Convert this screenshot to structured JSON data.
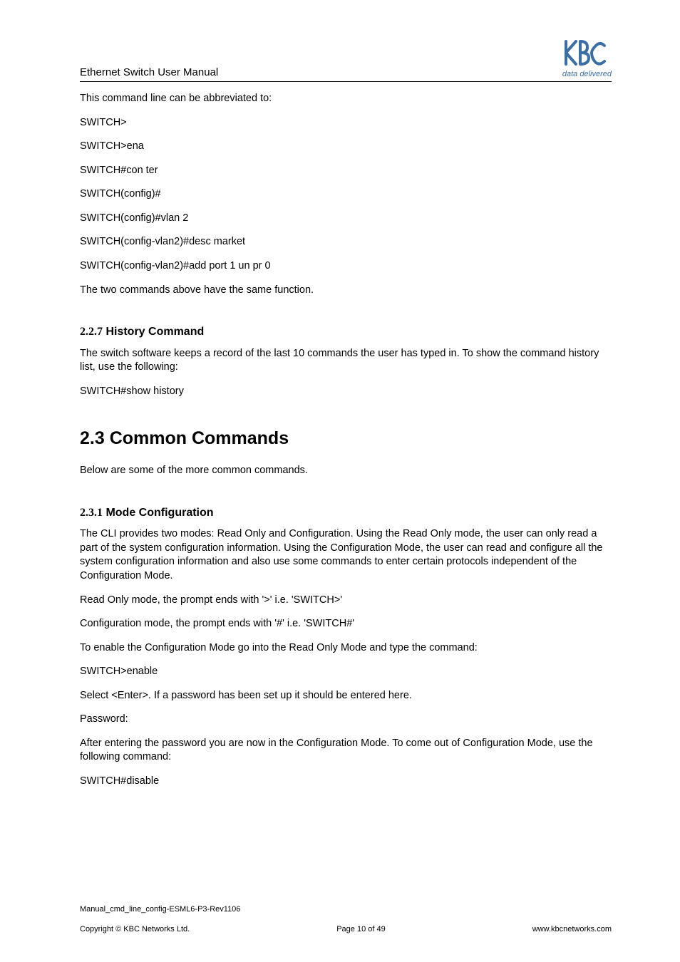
{
  "header": {
    "title": "Ethernet Switch User Manual",
    "tagline": "data delivered"
  },
  "body": {
    "intro": "This command line can be abbreviated to:",
    "cmd1": "SWITCH>",
    "cmd2": "SWITCH>ena",
    "cmd3": "SWITCH#con ter",
    "cmd4": "SWITCH(config)#",
    "cmd5": "SWITCH(config)#vlan 2",
    "cmd6": "SWITCH(config-vlan2)#desc market",
    "cmd7": "SWITCH(config-vlan2)#add port 1 un pr 0",
    "cmd_note": "The two commands above have the same function.",
    "sec227_num": "2.2.7",
    "sec227_title": " History Command",
    "sec227_p1": "The switch software keeps a record of the last 10 commands the user has typed in. To show the command history list, use the following:",
    "sec227_cmd": "SWITCH#show history",
    "sec23_title": "2.3 Common Commands",
    "sec23_p1": "Below are some of the more common commands.",
    "sec231_num": "2.3.1",
    "sec231_title": " Mode Configuration",
    "sec231_p1": "The CLI provides two modes: Read Only and Configuration. Using the Read Only mode, the user can only read a part of the system configuration information. Using the Configuration Mode, the user can read and configure all the system configuration information and also use some commands to enter certain protocols independent of the Configuration Mode.",
    "sec231_p2": "Read Only mode, the prompt ends with '>' i.e. 'SWITCH>'",
    "sec231_p3": "Configuration mode, the prompt ends with '#' i.e. 'SWITCH#'",
    "sec231_p4": "To enable the Configuration Mode go into the Read Only Mode and type the command:",
    "sec231_cmd1": "SWITCH>enable",
    "sec231_p5": "Select <Enter>. If a password has been set up it should be entered here.",
    "sec231_p6": "Password:",
    "sec231_p7": "After entering the password you are now in the Configuration Mode. To come out of Configuration Mode, use the following command:",
    "sec231_cmd2": "SWITCH#disable"
  },
  "footer": {
    "id": "Manual_cmd_line_config-ESML6-P3-Rev1106",
    "copyright": "Copyright © KBC Networks Ltd.",
    "page": "Page 10 of 49",
    "url": "www.kbcnetworks.com"
  }
}
